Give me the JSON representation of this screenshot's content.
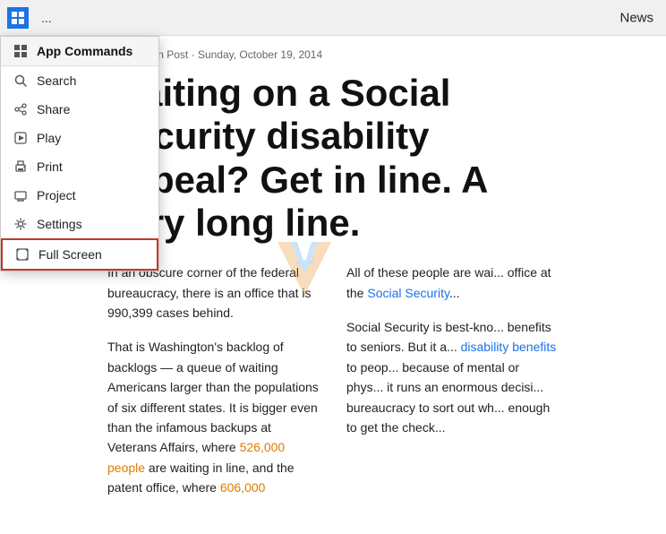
{
  "topbar": {
    "app_icon": "N",
    "ellipsis": "...",
    "title": "News"
  },
  "menu": {
    "items": [
      {
        "id": "app-commands",
        "label": "App Commands",
        "icon": "grid",
        "is_header": true
      },
      {
        "id": "search",
        "label": "Search",
        "icon": "search"
      },
      {
        "id": "share",
        "label": "Share",
        "icon": "share"
      },
      {
        "id": "play",
        "label": "Play",
        "icon": "play"
      },
      {
        "id": "print",
        "label": "Print",
        "icon": "print"
      },
      {
        "id": "project",
        "label": "Project",
        "icon": "project"
      },
      {
        "id": "settings",
        "label": "Settings",
        "icon": "settings"
      },
      {
        "id": "full-screen",
        "label": "Full Screen",
        "icon": "fullscreen",
        "highlighted": true
      }
    ]
  },
  "article": {
    "source": "Washington Post · Sunday, October 19, 2014",
    "headline": "Waiting on a Social Security disability appeal? Get in line. A very long line.",
    "body_col1_p1": "In an obscure corner of the federal bureaucracy, there is an office that is 990,399 cases behind.",
    "body_col1_p2": "That is Washington's backlog of backlogs — a queue of waiting Americans larger than the populations of six different states. It is bigger even than the infamous backups at Veterans Affairs, where 526,000 people are waiting in line, and the patent office, where 606,000",
    "body_col2_p1": "All of these people are wai... office at the Social Security...",
    "body_col2_p2": "Social Security is best-kno... benefits to seniors. But it a... disability benefits to peop... because of mental or phys... it runs an enormous decisi... bureaucracy to sort out wh... enough to get the check...",
    "link_veterans": "526,000 people",
    "link_patent": "606,000",
    "link_social_security": "Social Security",
    "link_disability": "disability benefits"
  }
}
